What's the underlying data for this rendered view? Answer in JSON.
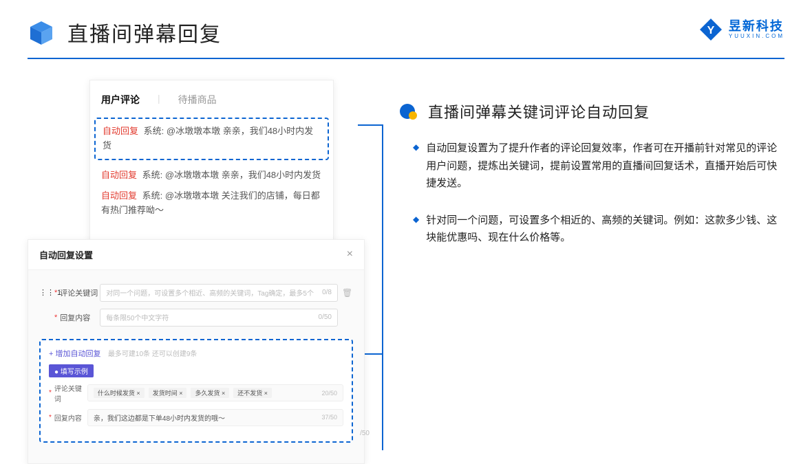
{
  "header": {
    "title": "直播间弹幕回复",
    "brand_cn": "昱新科技",
    "brand_en": "YUUXIN.COM"
  },
  "right": {
    "section_title": "直播间弹幕关键词评论自动回复",
    "bullets": [
      "自动回复设置为了提升作者的评论回复效率，作者可在开播前针对常见的评论用户问题，提炼出关键词，提前设置常用的直播间回复话术，直播开始后可快捷发送。",
      "针对同一个问题，可设置多个相近的、高频的关键词。例如：这款多少钱、这块能优惠吗、现在什么价格等。"
    ]
  },
  "comments": {
    "tabs": {
      "active": "用户评论",
      "inactive": "待播商品"
    },
    "highlighted": {
      "tag": "自动回复",
      "label": "系统:",
      "text": "@冰墩墩本墩 亲亲，我们48小时内发货"
    },
    "items": [
      {
        "tag": "自动回复",
        "label": "系统:",
        "text": "@冰墩墩本墩 亲亲，我们48小时内发货"
      },
      {
        "tag": "自动回复",
        "label": "系统:",
        "text": "@冰墩墩本墩 关注我们的店铺，每日都有热门推荐呦～"
      }
    ]
  },
  "settings": {
    "title": "自动回复设置",
    "index": "1",
    "keyword_label": "评论关键词",
    "keyword_placeholder": "对同一个问题，可设置多个相近、高频的关键词，Tag确定，最多5个",
    "keyword_counter": "0/8",
    "content_label": "回复内容",
    "content_placeholder": "每条限50个中文字符",
    "content_counter": "0/50",
    "add_link": "+ 增加自动回复",
    "add_hint": "最多可建10条 还可以创建9条",
    "example_badge": "● 填写示例",
    "ex_keyword_label": "评论关键词",
    "ex_keywords": [
      "什么时候发货",
      "发货时间",
      "多久发货",
      "还不发货"
    ],
    "ex_keyword_cnt": "20/50",
    "ex_content_label": "回复内容",
    "ex_content": "亲，我们这边都是下单48小时内发货的哦～",
    "ex_content_cnt": "37/50",
    "tail_cnt": "/50"
  }
}
